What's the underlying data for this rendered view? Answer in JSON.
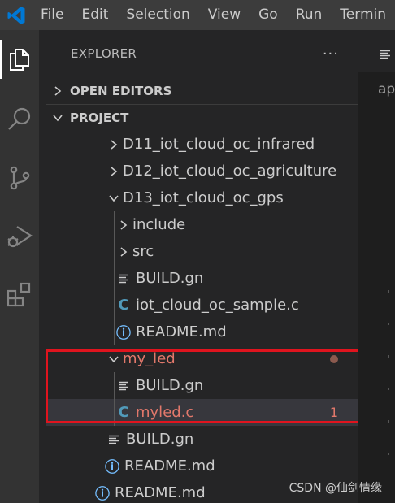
{
  "menu": {
    "items": [
      "File",
      "Edit",
      "Selection",
      "View",
      "Go",
      "Run",
      "Termin"
    ]
  },
  "activity_bar": {
    "icons": [
      "explorer-icon",
      "search-icon",
      "source-control-icon",
      "run-debug-icon",
      "extensions-icon"
    ]
  },
  "sidebar": {
    "title": "EXPLORER",
    "more_actions": "···",
    "sections": {
      "open_editors": "OPEN EDITORS",
      "project": "PROJECT"
    }
  },
  "tree": {
    "items": [
      {
        "label": "D11_iot_cloud_oc_infrared",
        "type": "folder",
        "expanded": false
      },
      {
        "label": "D12_iot_cloud_oc_agriculture",
        "type": "folder",
        "expanded": false
      },
      {
        "label": "D13_iot_cloud_oc_gps",
        "type": "folder",
        "expanded": true
      },
      {
        "label": "include",
        "type": "folder",
        "expanded": false
      },
      {
        "label": "src",
        "type": "folder",
        "expanded": false
      },
      {
        "label": "BUILD.gn",
        "type": "file",
        "icon": "lines-icon"
      },
      {
        "label": "iot_cloud_oc_sample.c",
        "type": "file",
        "icon": "c-file-icon",
        "icon_text": "C"
      },
      {
        "label": "README.md",
        "type": "file",
        "icon": "info-icon",
        "icon_text": "ⓘ"
      },
      {
        "label": "my_led",
        "type": "folder",
        "expanded": true,
        "modified": true
      },
      {
        "label": "BUILD.gn",
        "type": "file",
        "icon": "lines-icon"
      },
      {
        "label": "myled.c",
        "type": "file",
        "icon": "c-file-icon",
        "icon_text": "C",
        "modified": true,
        "problem_count": "1"
      },
      {
        "label": "BUILD.gn",
        "type": "file",
        "icon": "lines-icon"
      },
      {
        "label": "README.md",
        "type": "file",
        "icon": "info-icon",
        "icon_text": "ⓘ"
      },
      {
        "label": "README.md",
        "type": "file",
        "icon": "info-icon",
        "icon_text": "ⓘ"
      }
    ]
  },
  "editor": {
    "visible_text": "ap"
  },
  "colors": {
    "titlebar": "#3c3c3c",
    "activitybar": "#333333",
    "sidebar": "#252526",
    "editor": "#1e1e1e",
    "selection": "#37373d",
    "modified": "#e2786b",
    "highlight_box": "#e0141e",
    "vscode_blue": "#0078d4"
  },
  "watermark": "CSDN @仙剑情缘"
}
